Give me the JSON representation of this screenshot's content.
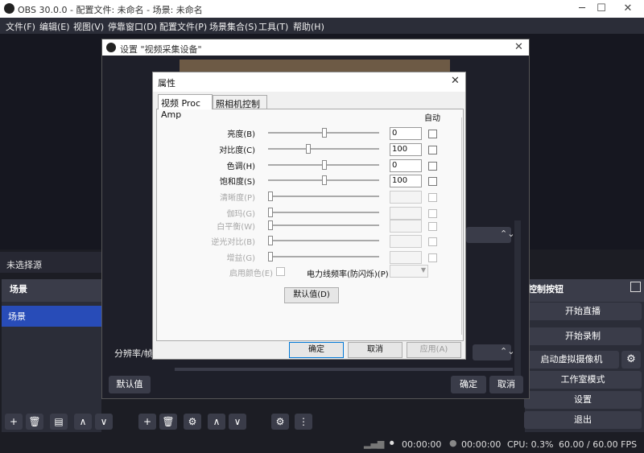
{
  "window": {
    "title": "OBS 30.0.0 - 配置文件: 未命名 - 场景: 未命名"
  },
  "menu": [
    "文件(F)",
    "编辑(E)",
    "视图(V)",
    "停靠窗口(D)",
    "配置文件(P)",
    "场景集合(S)",
    "工具(T)",
    "帮助(H)"
  ],
  "sources": {
    "no_selection": "未选择源"
  },
  "scenes": {
    "header": "场景",
    "items": [
      "场景"
    ]
  },
  "controls": {
    "header": "控制按钮",
    "start_stream": "开始直播",
    "start_record": "开始录制",
    "virtual_cam": "启动虚拟摄像机",
    "studio_mode": "工作室模式",
    "settings": "设置",
    "exit": "退出"
  },
  "status": {
    "stream_time": "00:00:00",
    "record_time": "00:00:00",
    "cpu": "CPU: 0.3%",
    "fps": "60.00 / 60.00 FPS"
  },
  "settings_dialog": {
    "title": "设置 \"视频采集设备\"",
    "res_label": "分辨率/帧率",
    "defaults": "默认值",
    "ok": "确定",
    "cancel": "取消"
  },
  "props_dialog": {
    "title": "属性",
    "tabs": [
      "视频 Proc Amp",
      "照相机控制"
    ],
    "auto_header": "自动",
    "rows": [
      {
        "label": "亮度(B)",
        "value": "0",
        "pos": 0.5,
        "enabled": true
      },
      {
        "label": "对比度(C)",
        "value": "100",
        "pos": 0.35,
        "enabled": true
      },
      {
        "label": "色调(H)",
        "value": "0",
        "pos": 0.5,
        "enabled": true
      },
      {
        "label": "饱和度(S)",
        "value": "100",
        "pos": 0.5,
        "enabled": true
      },
      {
        "label": "清晰度(P)",
        "value": "",
        "pos": 0.0,
        "enabled": false
      },
      {
        "label": "伽玛(G)",
        "value": "",
        "pos": 0.0,
        "enabled": false
      },
      {
        "label": "白平衡(W)",
        "value": "",
        "pos": 0.0,
        "enabled": false
      },
      {
        "label": "逆光对比(B)",
        "value": "",
        "pos": 0.0,
        "enabled": false
      },
      {
        "label": "增益(G)",
        "value": "",
        "pos": 0.0,
        "enabled": false
      }
    ],
    "color_enable": "启用颜色(E)",
    "powerline": "电力线频率(防闪烁)(P)",
    "defaults": "默认值(D)",
    "ok": "确定",
    "cancel": "取消",
    "apply": "应用(A)"
  }
}
